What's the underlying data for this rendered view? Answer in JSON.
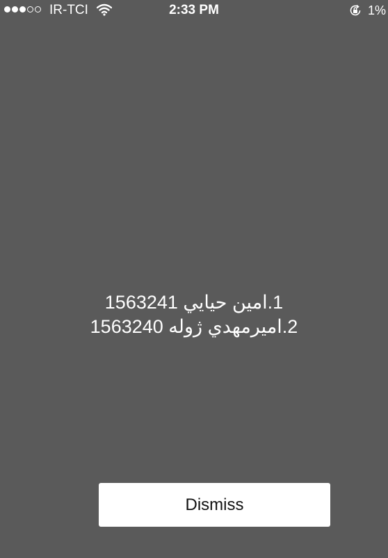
{
  "status_bar": {
    "signal_dots_filled": 3,
    "signal_dots_total": 5,
    "carrier": "IR-TCI",
    "time": "2:33 PM",
    "battery_percent": "1%",
    "icons": [
      "signal-dots-icon",
      "wifi-icon",
      "rotation-lock-icon"
    ]
  },
  "message": {
    "lines": [
      "1.امين حيايي 1563241",
      "2.اميرمهدي ژوله 1563240"
    ]
  },
  "dismiss_button": {
    "label": "Dismiss"
  },
  "colors": {
    "background": "#5a5a5a",
    "text": "#ffffff",
    "button_background": "#ffffff",
    "button_text": "#111111"
  }
}
